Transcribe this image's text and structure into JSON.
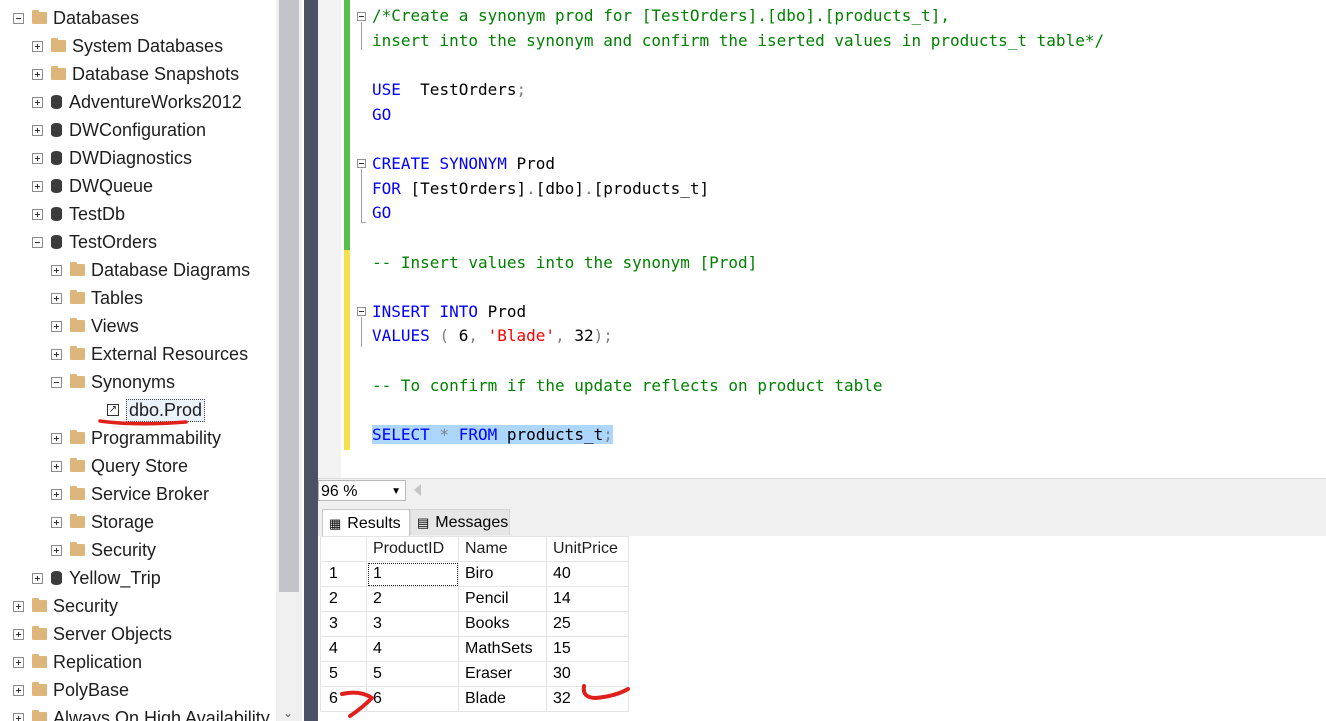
{
  "explorer": {
    "nodes": [
      {
        "label": "Databases",
        "indent": 0,
        "expander": "minus",
        "icon": "folder-icon"
      },
      {
        "label": "System Databases",
        "indent": 1,
        "expander": "plus",
        "icon": "folder-icon"
      },
      {
        "label": "Database Snapshots",
        "indent": 1,
        "expander": "plus",
        "icon": "folder-icon"
      },
      {
        "label": "AdventureWorks2012",
        "indent": 1,
        "expander": "plus",
        "icon": "database-icon"
      },
      {
        "label": "DWConfiguration",
        "indent": 1,
        "expander": "plus",
        "icon": "database-icon"
      },
      {
        "label": "DWDiagnostics",
        "indent": 1,
        "expander": "plus",
        "icon": "database-icon"
      },
      {
        "label": "DWQueue",
        "indent": 1,
        "expander": "plus",
        "icon": "database-icon"
      },
      {
        "label": "TestDb",
        "indent": 1,
        "expander": "plus",
        "icon": "database-icon"
      },
      {
        "label": "TestOrders",
        "indent": 1,
        "expander": "minus",
        "icon": "database-icon"
      },
      {
        "label": "Database Diagrams",
        "indent": 2,
        "expander": "plus",
        "icon": "folder-icon"
      },
      {
        "label": "Tables",
        "indent": 2,
        "expander": "plus",
        "icon": "folder-icon"
      },
      {
        "label": "Views",
        "indent": 2,
        "expander": "plus",
        "icon": "folder-icon"
      },
      {
        "label": "External Resources",
        "indent": 2,
        "expander": "plus",
        "icon": "folder-icon"
      },
      {
        "label": "Synonyms",
        "indent": 2,
        "expander": "minus",
        "icon": "folder-icon"
      },
      {
        "label": "dbo.Prod",
        "indent": 3,
        "expander": "none",
        "icon": "synonym-icon",
        "selected": true
      },
      {
        "label": "Programmability",
        "indent": 2,
        "expander": "plus",
        "icon": "folder-icon"
      },
      {
        "label": "Query Store",
        "indent": 2,
        "expander": "plus",
        "icon": "folder-icon"
      },
      {
        "label": "Service Broker",
        "indent": 2,
        "expander": "plus",
        "icon": "folder-icon"
      },
      {
        "label": "Storage",
        "indent": 2,
        "expander": "plus",
        "icon": "folder-icon"
      },
      {
        "label": "Security",
        "indent": 2,
        "expander": "plus",
        "icon": "folder-icon"
      },
      {
        "label": "Yellow_Trip",
        "indent": 1,
        "expander": "plus",
        "icon": "database-icon"
      },
      {
        "label": "Security",
        "indent": 0,
        "expander": "plus",
        "icon": "folder-icon"
      },
      {
        "label": "Server Objects",
        "indent": 0,
        "expander": "plus",
        "icon": "folder-icon"
      },
      {
        "label": "Replication",
        "indent": 0,
        "expander": "plus",
        "icon": "folder-icon"
      },
      {
        "label": "PolyBase",
        "indent": 0,
        "expander": "plus",
        "icon": "folder-icon"
      },
      {
        "label": "Always On High Availability",
        "indent": 0,
        "expander": "plus",
        "icon": "folder-icon"
      }
    ]
  },
  "editor": {
    "lines": [
      [
        [
          "cm",
          "/*Create a synonym prod for [TestOrders].[dbo].[products_t],"
        ]
      ],
      [
        [
          "cm",
          "insert into the synonym and confirm the iserted values in products_t table*/"
        ]
      ],
      [],
      [
        [
          "kw",
          "USE"
        ],
        [
          "",
          "  TestOrders"
        ],
        [
          "gy",
          ";"
        ]
      ],
      [
        [
          "kw",
          "GO"
        ]
      ],
      [],
      [
        [
          "kw",
          "CREATE"
        ],
        [
          "",
          " "
        ],
        [
          "kw",
          "SYNONYM"
        ],
        [
          "",
          " Prod"
        ]
      ],
      [
        [
          "kw",
          "FOR"
        ],
        [
          "",
          " [TestOrders]"
        ],
        [
          "gy",
          "."
        ],
        [
          "",
          "[dbo]"
        ],
        [
          "gy",
          "."
        ],
        [
          "",
          "[products_t]"
        ]
      ],
      [
        [
          "kw",
          "GO"
        ]
      ],
      [],
      [
        [
          "cm",
          "-- Insert values into the synonym [Prod]"
        ]
      ],
      [],
      [
        [
          "kw",
          "INSERT"
        ],
        [
          "",
          " "
        ],
        [
          "kw",
          "INTO"
        ],
        [
          "",
          " Prod"
        ]
      ],
      [
        [
          "kw",
          "VALUES"
        ],
        [
          "",
          " "
        ],
        [
          "gy",
          "("
        ],
        [
          "",
          " 6"
        ],
        [
          "gy",
          ","
        ],
        [
          "",
          " "
        ],
        [
          "str",
          "'Blade'"
        ],
        [
          "gy",
          ","
        ],
        [
          "",
          " 32"
        ],
        [
          "gy",
          ");"
        ]
      ],
      [],
      [
        [
          "cm",
          "-- To confirm if the update reflects on product table"
        ]
      ],
      [],
      [
        [
          "kw",
          "SELECT"
        ],
        [
          "",
          " "
        ],
        [
          "gy",
          "*"
        ],
        [
          "",
          " "
        ],
        [
          "kw",
          "FROM"
        ],
        [
          "",
          " products_t"
        ],
        [
          "gy",
          ";"
        ]
      ]
    ]
  },
  "zoom": {
    "value": "96 %"
  },
  "tabs": {
    "results": "Results",
    "messages": "Messages"
  },
  "results": {
    "columns": [
      "",
      "ProductID",
      "Name",
      "UnitPrice"
    ],
    "rows": [
      [
        "1",
        "1",
        "Biro",
        "40"
      ],
      [
        "2",
        "2",
        "Pencil",
        "14"
      ],
      [
        "3",
        "3",
        "Books",
        "25"
      ],
      [
        "4",
        "4",
        "MathSets",
        "15"
      ],
      [
        "5",
        "5",
        "Eraser",
        "30"
      ],
      [
        "6",
        "6",
        "Blade",
        "32"
      ]
    ]
  },
  "colors": {
    "change_saved": "#57c24a",
    "change_unsaved": "#f3e24b",
    "annotation": "#e0201b",
    "selection": "#add6ff"
  }
}
